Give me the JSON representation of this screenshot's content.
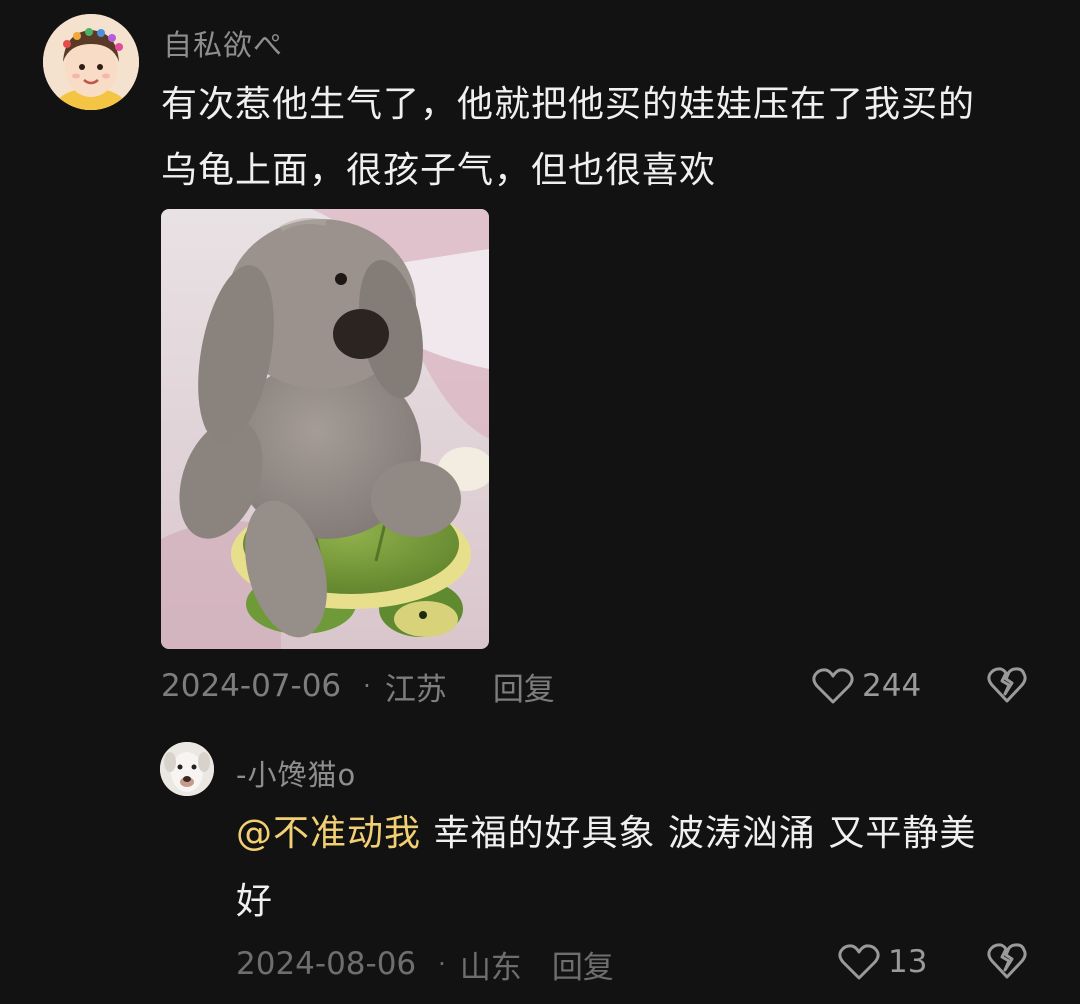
{
  "comment": {
    "username": "自私欲ぺ",
    "text_line1": "有次惹他生气了，他就把他买的娃娃压在了我买的",
    "text_line2": "乌龟上面，很孩子气，但也很喜欢",
    "date": "2024-07-06",
    "separator": "·",
    "location": "江苏",
    "reply_label": "回复",
    "like_count": "244",
    "like_icon": "heart-outline-icon",
    "dislike_icon": "broken-heart-icon"
  },
  "reply": {
    "username": "-小馋猫o",
    "mention": "@不准动我",
    "text_line1": " 幸福的好具象 波涛汹涌 又平静美",
    "text_line2": "好",
    "date": "2024-08-06",
    "separator": "·",
    "location": "山东",
    "reply_label": "回复",
    "like_count": "13",
    "like_icon": "heart-outline-icon",
    "dislike_icon": "broken-heart-icon"
  },
  "colors": {
    "background": "#121212",
    "mention": "#f2cf72",
    "meta_text": "#7d7d7d"
  }
}
